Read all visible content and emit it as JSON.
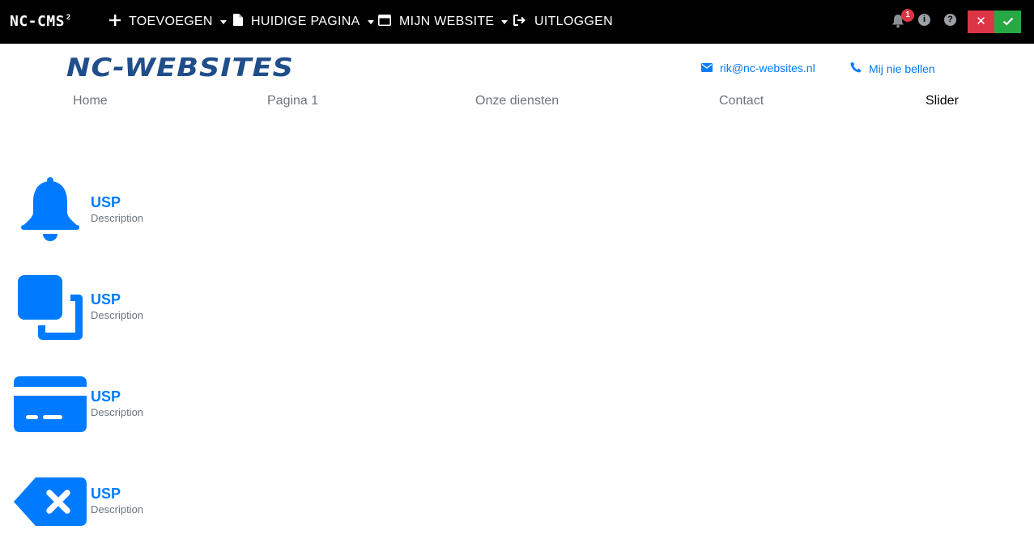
{
  "cms": {
    "brand": "NC-CMS",
    "brand_sup": "2",
    "menu": [
      {
        "label": "TOEVOEGEN",
        "icon": "plus-icon"
      },
      {
        "label": "HUIDIGE PAGINA",
        "icon": "file-icon"
      },
      {
        "label": "MIJN WEBSITE",
        "icon": "window-icon"
      },
      {
        "label": "UITLOGGEN",
        "icon": "sign-out-icon"
      }
    ],
    "notification_count": "1",
    "info_symbol": "i",
    "help_symbol": "?",
    "cancel_symbol": "✕"
  },
  "site": {
    "logo": "NC-WEBSITES",
    "email": "rik@nc-websites.nl",
    "phone_label": "Mij nie bellen",
    "nav": [
      {
        "label": "Home"
      },
      {
        "label": "Pagina 1"
      },
      {
        "label": "Onze diensten"
      },
      {
        "label": "Contact"
      },
      {
        "label": "Slider",
        "active": true
      }
    ],
    "accent_color": "#007bff"
  },
  "usps": [
    {
      "title": "USP",
      "description": "Description",
      "icon": "bell-icon"
    },
    {
      "title": "USP",
      "description": "Description",
      "icon": "clone-icon"
    },
    {
      "title": "USP",
      "description": "Description",
      "icon": "credit-card-icon"
    },
    {
      "title": "USP",
      "description": "Description",
      "icon": "backspace-icon"
    }
  ]
}
